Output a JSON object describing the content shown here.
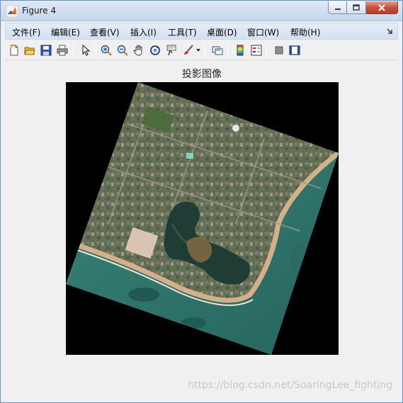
{
  "window": {
    "title": "Figure 4",
    "controls": {
      "minimize": "minimize",
      "maximize": "maximize",
      "close": "close"
    }
  },
  "menubar": {
    "items": [
      {
        "label": "文件(F)"
      },
      {
        "label": "编辑(E)"
      },
      {
        "label": "查看(V)"
      },
      {
        "label": "插入(I)"
      },
      {
        "label": "工具(T)"
      },
      {
        "label": "桌面(D)"
      },
      {
        "label": "窗口(W)"
      },
      {
        "label": "帮助(H)"
      }
    ]
  },
  "toolbar": {
    "buttons": [
      "new-figure-icon",
      "open-file-icon",
      "save-icon",
      "print-icon",
      "edit-plot-arrow-icon",
      "zoom-in-icon",
      "zoom-out-icon",
      "pan-hand-icon",
      "rotate-3d-icon",
      "data-cursor-icon",
      "brush-icon",
      "link-plot-icon",
      "colorbar-icon",
      "legend-icon",
      "hide-plot-tools-icon",
      "show-plot-tools-icon"
    ]
  },
  "axes": {
    "title": "投影图像",
    "image": "rotated aerial satellite image of coastal campus with lagoon"
  },
  "watermark": "https://blog.csdn.net/SoaringLee_fighting",
  "colors": {
    "title_bar": "#c6d6ec",
    "menu_bar": "#d5e1f1",
    "figure_bg": "#f0f0f0",
    "image_bg": "#000000",
    "close_button": "#c8503b",
    "ocean": "#2f7268",
    "lagoon": "#1f3d35",
    "beach": "#c9a27a"
  }
}
